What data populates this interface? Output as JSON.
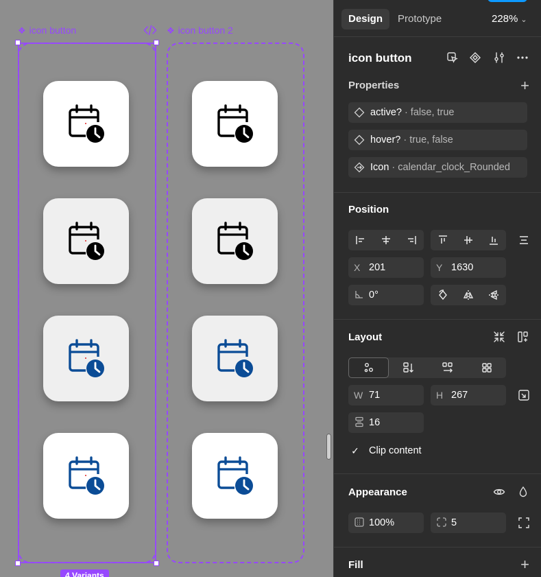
{
  "canvas": {
    "frame1_label": "icon button",
    "frame2_label": "icon button 2",
    "variants_chip": "4 Variants",
    "accent_color": "#9747ff",
    "icon_black": "#000000",
    "icon_blue": "#0b4c96",
    "buttons": [
      {
        "frame": 1,
        "bg": "white",
        "color": "black"
      },
      {
        "frame": 1,
        "bg": "grey",
        "color": "black"
      },
      {
        "frame": 1,
        "bg": "grey",
        "color": "blue"
      },
      {
        "frame": 1,
        "bg": "white",
        "color": "blue"
      },
      {
        "frame": 2,
        "bg": "white",
        "color": "black"
      },
      {
        "frame": 2,
        "bg": "grey",
        "color": "black"
      },
      {
        "frame": 2,
        "bg": "grey",
        "color": "blue"
      },
      {
        "frame": 2,
        "bg": "white",
        "color": "blue"
      }
    ]
  },
  "panel": {
    "tabs": [
      "Design",
      "Prototype"
    ],
    "zoom": "228%",
    "component_name": "icon button",
    "properties": {
      "title": "Properties",
      "items": [
        {
          "name": "active?",
          "value": "· false, true"
        },
        {
          "name": "hover?",
          "value": "· true, false"
        },
        {
          "name": "Icon",
          "value": "· calendar_clock_Rounded"
        }
      ]
    },
    "position": {
      "title": "Position",
      "x_label": "X",
      "x": "201",
      "y_label": "Y",
      "y": "1630",
      "rotation": "0°"
    },
    "layout": {
      "title": "Layout",
      "w_label": "W",
      "w": "71",
      "h_label": "H",
      "h": "267",
      "gap": "16",
      "clip_content": "Clip content"
    },
    "appearance": {
      "title": "Appearance",
      "opacity": "100%",
      "radius": "5"
    },
    "fill": {
      "title": "Fill"
    }
  }
}
